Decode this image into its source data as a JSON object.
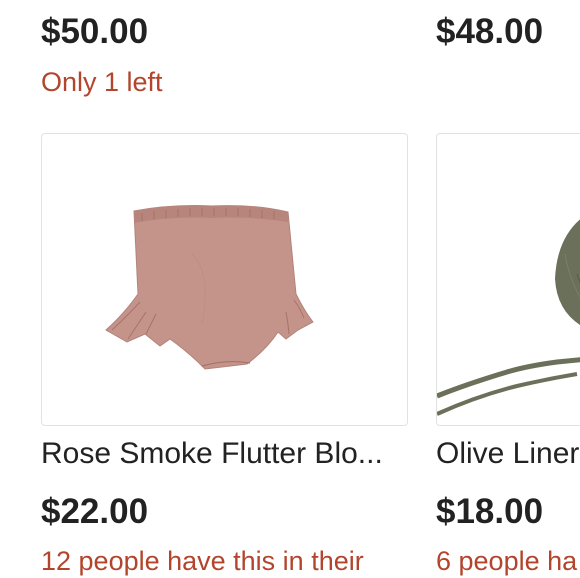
{
  "listings": [
    {
      "price": "$50.00",
      "stock_note": "Only 1 left"
    },
    {
      "price": "$48.00"
    },
    {
      "title": "Rose Smoke Flutter Blo...",
      "price": "$22.00",
      "social_note": "12 people have this in their",
      "image_icon": "bloomers-product-photo",
      "product_color": "#c4948b"
    },
    {
      "title": "Olive Liner",
      "price": "$18.00",
      "social_note": "6 people ha",
      "image_icon": "bonnet-product-photo",
      "product_color": "#6b705a"
    }
  ],
  "colors": {
    "price_text": "#222222",
    "accent_red": "#b2452c",
    "card_border": "#e1e3df"
  }
}
